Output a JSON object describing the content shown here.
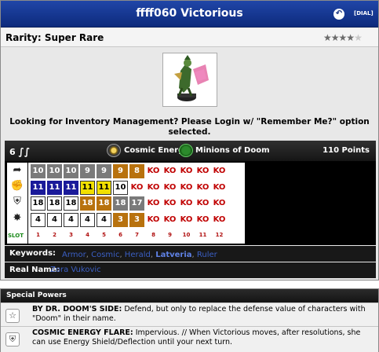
{
  "header": {
    "title": "ffff060 Victorious",
    "dial_link": "[DIAL]",
    "undo_icon": "undo-icon"
  },
  "rarity": {
    "label": "Rarity: Super Rare",
    "stars_filled": 4,
    "stars_total": 5
  },
  "figure": {
    "icon": "figure-image"
  },
  "notice": "Looking for Inventory Management? Please Login w/ \"Remember Me?\" option selected.",
  "dial": {
    "range": "6",
    "teams": [
      {
        "label": "Cosmic Energy",
        "icon": "cosmic-energy-icon"
      },
      {
        "label": "Minions of Doom",
        "icon": "minions-of-doom-icon"
      }
    ],
    "points": "110 Points",
    "stat_icons": [
      "speed-wing-icon",
      "attack-fist-icon",
      "defense-shield-icon",
      "damage-burst-icon"
    ],
    "slot_label": "SLOT",
    "slots": [
      "1",
      "2",
      "3",
      "4",
      "5",
      "6",
      "7",
      "8",
      "9",
      "10",
      "11",
      "12"
    ],
    "rows": [
      [
        "10",
        "10",
        "10",
        "9",
        "9",
        "9",
        "8",
        "KO",
        "KO",
        "KO",
        "KO",
        "KO"
      ],
      [
        "11",
        "11",
        "11",
        "11",
        "11",
        "10",
        "KO",
        "KO",
        "KO",
        "KO",
        "KO",
        "KO"
      ],
      [
        "18",
        "18",
        "18",
        "18",
        "18",
        "18",
        "17",
        "KO",
        "KO",
        "KO",
        "KO",
        "KO"
      ],
      [
        "4",
        "4",
        "4",
        "4",
        "4",
        "3",
        "3",
        "KO",
        "KO",
        "KO",
        "KO",
        "KO"
      ]
    ],
    "colors": [
      [
        "gray",
        "gray",
        "gray",
        "gray",
        "gray",
        "orange",
        "orange",
        "ko",
        "ko",
        "ko",
        "ko",
        "ko"
      ],
      [
        "blue",
        "blue",
        "blue",
        "yellow",
        "yellow",
        "white",
        "ko",
        "ko",
        "ko",
        "ko",
        "ko",
        "ko"
      ],
      [
        "white",
        "white",
        "white",
        "orange",
        "orange",
        "gray",
        "gray",
        "ko",
        "ko",
        "ko",
        "ko",
        "ko"
      ],
      [
        "white",
        "white",
        "white",
        "white",
        "white",
        "orange",
        "orange",
        "ko",
        "ko",
        "ko",
        "ko",
        "ko"
      ]
    ],
    "palette": {
      "gray": "#7a7a7a",
      "orange": "#b8720e",
      "blue": "#1a1a9a",
      "yellow": "#f2e000",
      "white": "#ffffff",
      "ko": "#ffffff",
      "ko_text": "#c00000"
    }
  },
  "keywords": {
    "label": "Keywords:",
    "items": [
      {
        "text": "Armor",
        "bold": false
      },
      {
        "text": "Cosmic",
        "bold": false
      },
      {
        "text": "Herald",
        "bold": false
      },
      {
        "text": "Latveria",
        "bold": true
      },
      {
        "text": "Ruler",
        "bold": false
      }
    ]
  },
  "real_name": {
    "label": "Real Name:",
    "value": "Zora Vukovic"
  },
  "special_powers": {
    "title": "Special Powers",
    "powers": [
      {
        "icon": "defense-star-icon",
        "name": "BY DR. DOOM'S SIDE:",
        "text": " Defend, but only to replace the defense value of characters with \"Doom\" in their name."
      },
      {
        "icon": "defense-shield-icon",
        "name": "COSMIC ENERGY FLARE:",
        "text": " Impervious. // When Victorious moves, after resolutions, she can use Energy Shield/Deflection until your next turn."
      }
    ]
  }
}
